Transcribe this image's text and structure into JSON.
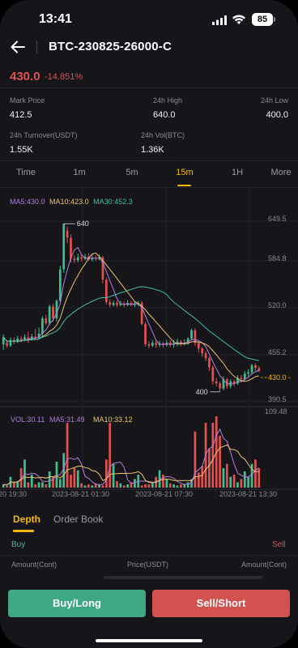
{
  "status_bar": {
    "time": "13:41",
    "battery": "85"
  },
  "header": {
    "symbol": "BTC-230825-26000-C"
  },
  "ticker": {
    "last_price": "430.0",
    "change_pct": "-14.851%"
  },
  "stats": {
    "mark_price_label": "Mark Price",
    "mark_price": "412.5",
    "high_label": "24h High",
    "high": "640.0",
    "low_label": "24h Low",
    "low": "400.0",
    "turnover_label": "24h Turnover(USDT)",
    "turnover": "1.55K",
    "vol_label": "24h Vol(BTC)",
    "vol": "1.36K"
  },
  "intervals": [
    {
      "label": "Time",
      "active": false
    },
    {
      "label": "1m",
      "active": false
    },
    {
      "label": "5m",
      "active": false
    },
    {
      "label": "15m",
      "active": true
    },
    {
      "label": "1H",
      "active": false
    },
    {
      "label": "More",
      "active": false
    }
  ],
  "ma_legend": {
    "ma5": "MA5:430.0",
    "ma10": "MA10:423.0",
    "ma30": "MA30:452.3"
  },
  "vol_legend": {
    "vol": "VOL:30.11",
    "ma5": "MA5:31.49",
    "ma10": "MA10:33.12",
    "max": "109.48"
  },
  "colors": {
    "up": "#3fbf8f",
    "down": "#e0524f",
    "ma5": "#b57edc",
    "ma10": "#f0c36b",
    "ma30": "#3fbfa5",
    "accent": "#f0b90b"
  },
  "chart_data": {
    "type": "candlestick",
    "y_ticks": [
      "649.5",
      "584.8",
      "520.0",
      "455.2",
      "390.5"
    ],
    "ylim": [
      390.5,
      649.5
    ],
    "x_ticks": [
      "20 19:30",
      "2023-08-21 01:30",
      "2023-08-21 07:30",
      "2023-08-21 13:30"
    ],
    "last_price_label": "430.0",
    "high_marker": "640",
    "low_marker": "400",
    "candles": [
      {
        "o": 468,
        "c": 478,
        "h": 482,
        "l": 460
      },
      {
        "o": 470,
        "c": 466,
        "h": 474,
        "l": 463
      },
      {
        "o": 466,
        "c": 474,
        "h": 478,
        "l": 464
      },
      {
        "o": 474,
        "c": 471,
        "h": 478,
        "l": 468
      },
      {
        "o": 471,
        "c": 476,
        "h": 480,
        "l": 470
      },
      {
        "o": 476,
        "c": 474,
        "h": 480,
        "l": 471
      },
      {
        "o": 474,
        "c": 478,
        "h": 482,
        "l": 472
      },
      {
        "o": 478,
        "c": 475,
        "h": 486,
        "l": 470
      },
      {
        "o": 475,
        "c": 479,
        "h": 483,
        "l": 473
      },
      {
        "o": 479,
        "c": 477,
        "h": 490,
        "l": 474
      },
      {
        "o": 477,
        "c": 483,
        "h": 492,
        "l": 475
      },
      {
        "o": 483,
        "c": 505,
        "h": 508,
        "l": 480
      },
      {
        "o": 505,
        "c": 498,
        "h": 510,
        "l": 495
      },
      {
        "o": 498,
        "c": 522,
        "h": 525,
        "l": 496
      },
      {
        "o": 522,
        "c": 505,
        "h": 526,
        "l": 500
      },
      {
        "o": 505,
        "c": 530,
        "h": 532,
        "l": 500
      },
      {
        "o": 530,
        "c": 575,
        "h": 580,
        "l": 528
      },
      {
        "o": 575,
        "c": 640,
        "h": 640,
        "l": 570
      },
      {
        "o": 630,
        "c": 620,
        "h": 636,
        "l": 612
      },
      {
        "o": 620,
        "c": 590,
        "h": 625,
        "l": 585
      },
      {
        "o": 590,
        "c": 588,
        "h": 595,
        "l": 584
      },
      {
        "o": 588,
        "c": 592,
        "h": 597,
        "l": 585
      },
      {
        "o": 592,
        "c": 590,
        "h": 596,
        "l": 586
      },
      {
        "o": 590,
        "c": 593,
        "h": 597,
        "l": 588
      },
      {
        "o": 593,
        "c": 589,
        "h": 598,
        "l": 587
      },
      {
        "o": 589,
        "c": 591,
        "h": 596,
        "l": 586
      },
      {
        "o": 591,
        "c": 590,
        "h": 595,
        "l": 587
      },
      {
        "o": 590,
        "c": 592,
        "h": 596,
        "l": 588
      },
      {
        "o": 592,
        "c": 560,
        "h": 594,
        "l": 555
      },
      {
        "o": 560,
        "c": 528,
        "h": 563,
        "l": 525
      },
      {
        "o": 528,
        "c": 524,
        "h": 532,
        "l": 521
      },
      {
        "o": 524,
        "c": 527,
        "h": 530,
        "l": 522
      },
      {
        "o": 527,
        "c": 524,
        "h": 530,
        "l": 521
      },
      {
        "o": 524,
        "c": 526,
        "h": 530,
        "l": 522
      },
      {
        "o": 526,
        "c": 524,
        "h": 529,
        "l": 521
      },
      {
        "o": 524,
        "c": 527,
        "h": 531,
        "l": 522
      },
      {
        "o": 527,
        "c": 524,
        "h": 530,
        "l": 522
      },
      {
        "o": 524,
        "c": 526,
        "h": 529,
        "l": 521
      },
      {
        "o": 526,
        "c": 527,
        "h": 530,
        "l": 522
      },
      {
        "o": 527,
        "c": 497,
        "h": 530,
        "l": 495
      },
      {
        "o": 497,
        "c": 468,
        "h": 500,
        "l": 465
      },
      {
        "o": 468,
        "c": 466,
        "h": 472,
        "l": 462
      },
      {
        "o": 466,
        "c": 470,
        "h": 474,
        "l": 464
      },
      {
        "o": 470,
        "c": 467,
        "h": 473,
        "l": 463
      },
      {
        "o": 467,
        "c": 469,
        "h": 473,
        "l": 464
      },
      {
        "o": 469,
        "c": 467,
        "h": 472,
        "l": 463
      },
      {
        "o": 467,
        "c": 470,
        "h": 474,
        "l": 465
      },
      {
        "o": 470,
        "c": 467,
        "h": 473,
        "l": 464
      },
      {
        "o": 467,
        "c": 469,
        "h": 474,
        "l": 463
      },
      {
        "o": 469,
        "c": 472,
        "h": 476,
        "l": 465
      },
      {
        "o": 472,
        "c": 468,
        "h": 474,
        "l": 465
      },
      {
        "o": 468,
        "c": 470,
        "h": 475,
        "l": 466
      },
      {
        "o": 470,
        "c": 476,
        "h": 478,
        "l": 467
      },
      {
        "o": 476,
        "c": 488,
        "h": 490,
        "l": 474
      },
      {
        "o": 488,
        "c": 470,
        "h": 491,
        "l": 466
      },
      {
        "o": 470,
        "c": 462,
        "h": 472,
        "l": 456
      },
      {
        "o": 462,
        "c": 455,
        "h": 464,
        "l": 450
      },
      {
        "o": 455,
        "c": 448,
        "h": 458,
        "l": 444
      },
      {
        "o": 448,
        "c": 435,
        "h": 450,
        "l": 430
      },
      {
        "o": 435,
        "c": 415,
        "h": 438,
        "l": 410
      },
      {
        "o": 415,
        "c": 412,
        "h": 420,
        "l": 408
      },
      {
        "o": 412,
        "c": 405,
        "h": 415,
        "l": 400
      },
      {
        "o": 405,
        "c": 418,
        "h": 422,
        "l": 402
      },
      {
        "o": 418,
        "c": 408,
        "h": 420,
        "l": 404
      },
      {
        "o": 408,
        "c": 415,
        "h": 418,
        "l": 405
      },
      {
        "o": 415,
        "c": 412,
        "h": 418,
        "l": 408
      },
      {
        "o": 412,
        "c": 420,
        "h": 424,
        "l": 410
      },
      {
        "o": 420,
        "c": 418,
        "h": 424,
        "l": 414
      },
      {
        "o": 418,
        "c": 426,
        "h": 430,
        "l": 416
      },
      {
        "o": 426,
        "c": 428,
        "h": 432,
        "l": 422
      },
      {
        "o": 428,
        "c": 438,
        "h": 440,
        "l": 425
      },
      {
        "o": 438,
        "c": 434,
        "h": 441,
        "l": 430
      },
      {
        "o": 434,
        "c": 430,
        "h": 437,
        "l": 428
      }
    ],
    "volumes": [
      3,
      2,
      10,
      5,
      6,
      18,
      26,
      5,
      12,
      3,
      5,
      5,
      3,
      15,
      10,
      24,
      8,
      32,
      60,
      12,
      18,
      16,
      4,
      2,
      3,
      2,
      4,
      3,
      2,
      26,
      60,
      22,
      6,
      4,
      2,
      3,
      5,
      8,
      12,
      2,
      3,
      3,
      5,
      10,
      16,
      12,
      8,
      4,
      3,
      2,
      3,
      3,
      5,
      8,
      52,
      14,
      20,
      60,
      36,
      60,
      66,
      48,
      18,
      22,
      10,
      12,
      5,
      8,
      15,
      10,
      22,
      26,
      18
    ]
  },
  "depth": {
    "tabs": [
      {
        "label": "Depth",
        "active": true
      },
      {
        "label": "Order Book",
        "active": false
      }
    ],
    "buy_label": "Buy",
    "sell_label": "Sell",
    "col_amount_left": "Amount(Cont)",
    "col_price": "Price(USDT)",
    "col_amount_right": "Amount(Cont)"
  },
  "actions": {
    "buy": "Buy/Long",
    "sell": "Sell/Short"
  }
}
